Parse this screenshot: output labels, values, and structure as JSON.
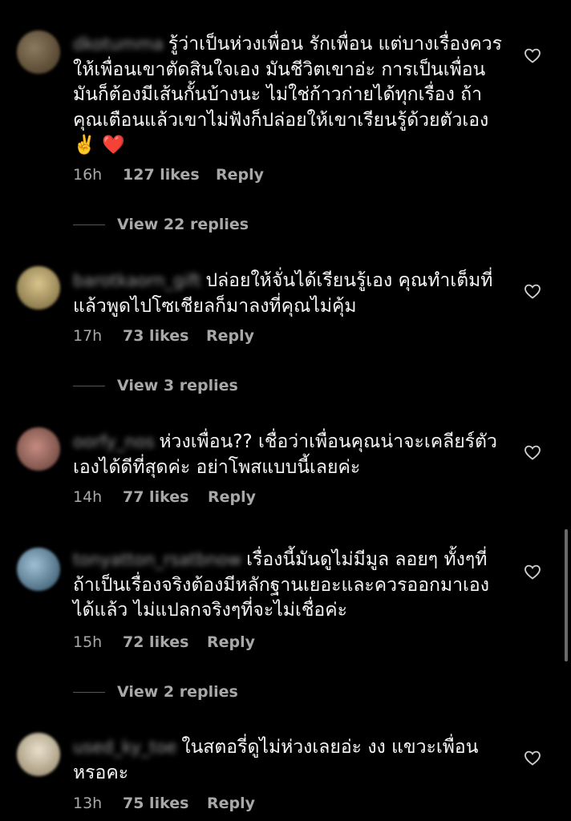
{
  "comments": [
    {
      "username": "dkotumma",
      "text": "รู้ว่าเป็นห่วงเพื่อน รักเพื่อน แต่บางเรื่องควรให้เพื่อนเขาตัดสินใจเอง มันชีวิตเขาอ่ะ การเป็นเพื่อนมันก็ต้องมีเส้นกั้นบ้างนะ ไม่ใช่ก้าวก่ายได้ทุกเรื่อง ถ้าคุณเตือนแล้วเขาไม่ฟังก็ปล่อยให้เขาเรียนรู้ด้วยตัวเอง ✌️ ❤️",
      "time": "16h",
      "likes": "127 likes",
      "reply": "Reply",
      "view_replies": "View 22 replies"
    },
    {
      "username": "barotkaorn_gift",
      "text": "ปล่อยให้จั่นได้เรียนรู้เอง คุณทำเต็มที่แล้วพูดไปโซเชียลก็มาลงที่คุณไม่คุ้ม",
      "time": "17h",
      "likes": "73 likes",
      "reply": "Reply",
      "view_replies": "View 3 replies"
    },
    {
      "username": "oorfy_nos",
      "text": "ห่วงเพื่อน?? เชื่อว่าเพื่อนคุณน่าจะเคลียร์ตัวเองได้ดีที่สุดค่ะ อย่าโพสแบบนี้เลยค่ะ",
      "time": "14h",
      "likes": "77 likes",
      "reply": "Reply",
      "view_replies": ""
    },
    {
      "username": "tonyatton_rsatbnow",
      "text": "เรื่องนี้มันดูไม่มีมูล ลอยๆ ทั้งๆที่ถ้าเป็นเรื่องจริงต้องมีหลักฐานเยอะและควรออกมาเองได้แล้ว ไม่แปลกจริงๆที่จะไม่เชื่อค่ะ",
      "time": "15h",
      "likes": "72 likes",
      "reply": "Reply",
      "view_replies": "View 2 replies"
    },
    {
      "username": "used_ky_toe",
      "text": "ในสตอรี่ดูไม่ห่วงเลยอ่ะ งง แขวะเพื่อนหรอคะ",
      "time": "13h",
      "likes": "75 likes",
      "reply": "Reply",
      "view_replies": ""
    }
  ],
  "avatar_colors": [
    "#6b5a43",
    "#b9a673",
    "#a5736b",
    "#5b7f98",
    "#cfc6b2"
  ],
  "icons": {
    "like": "heart-outline-icon"
  }
}
